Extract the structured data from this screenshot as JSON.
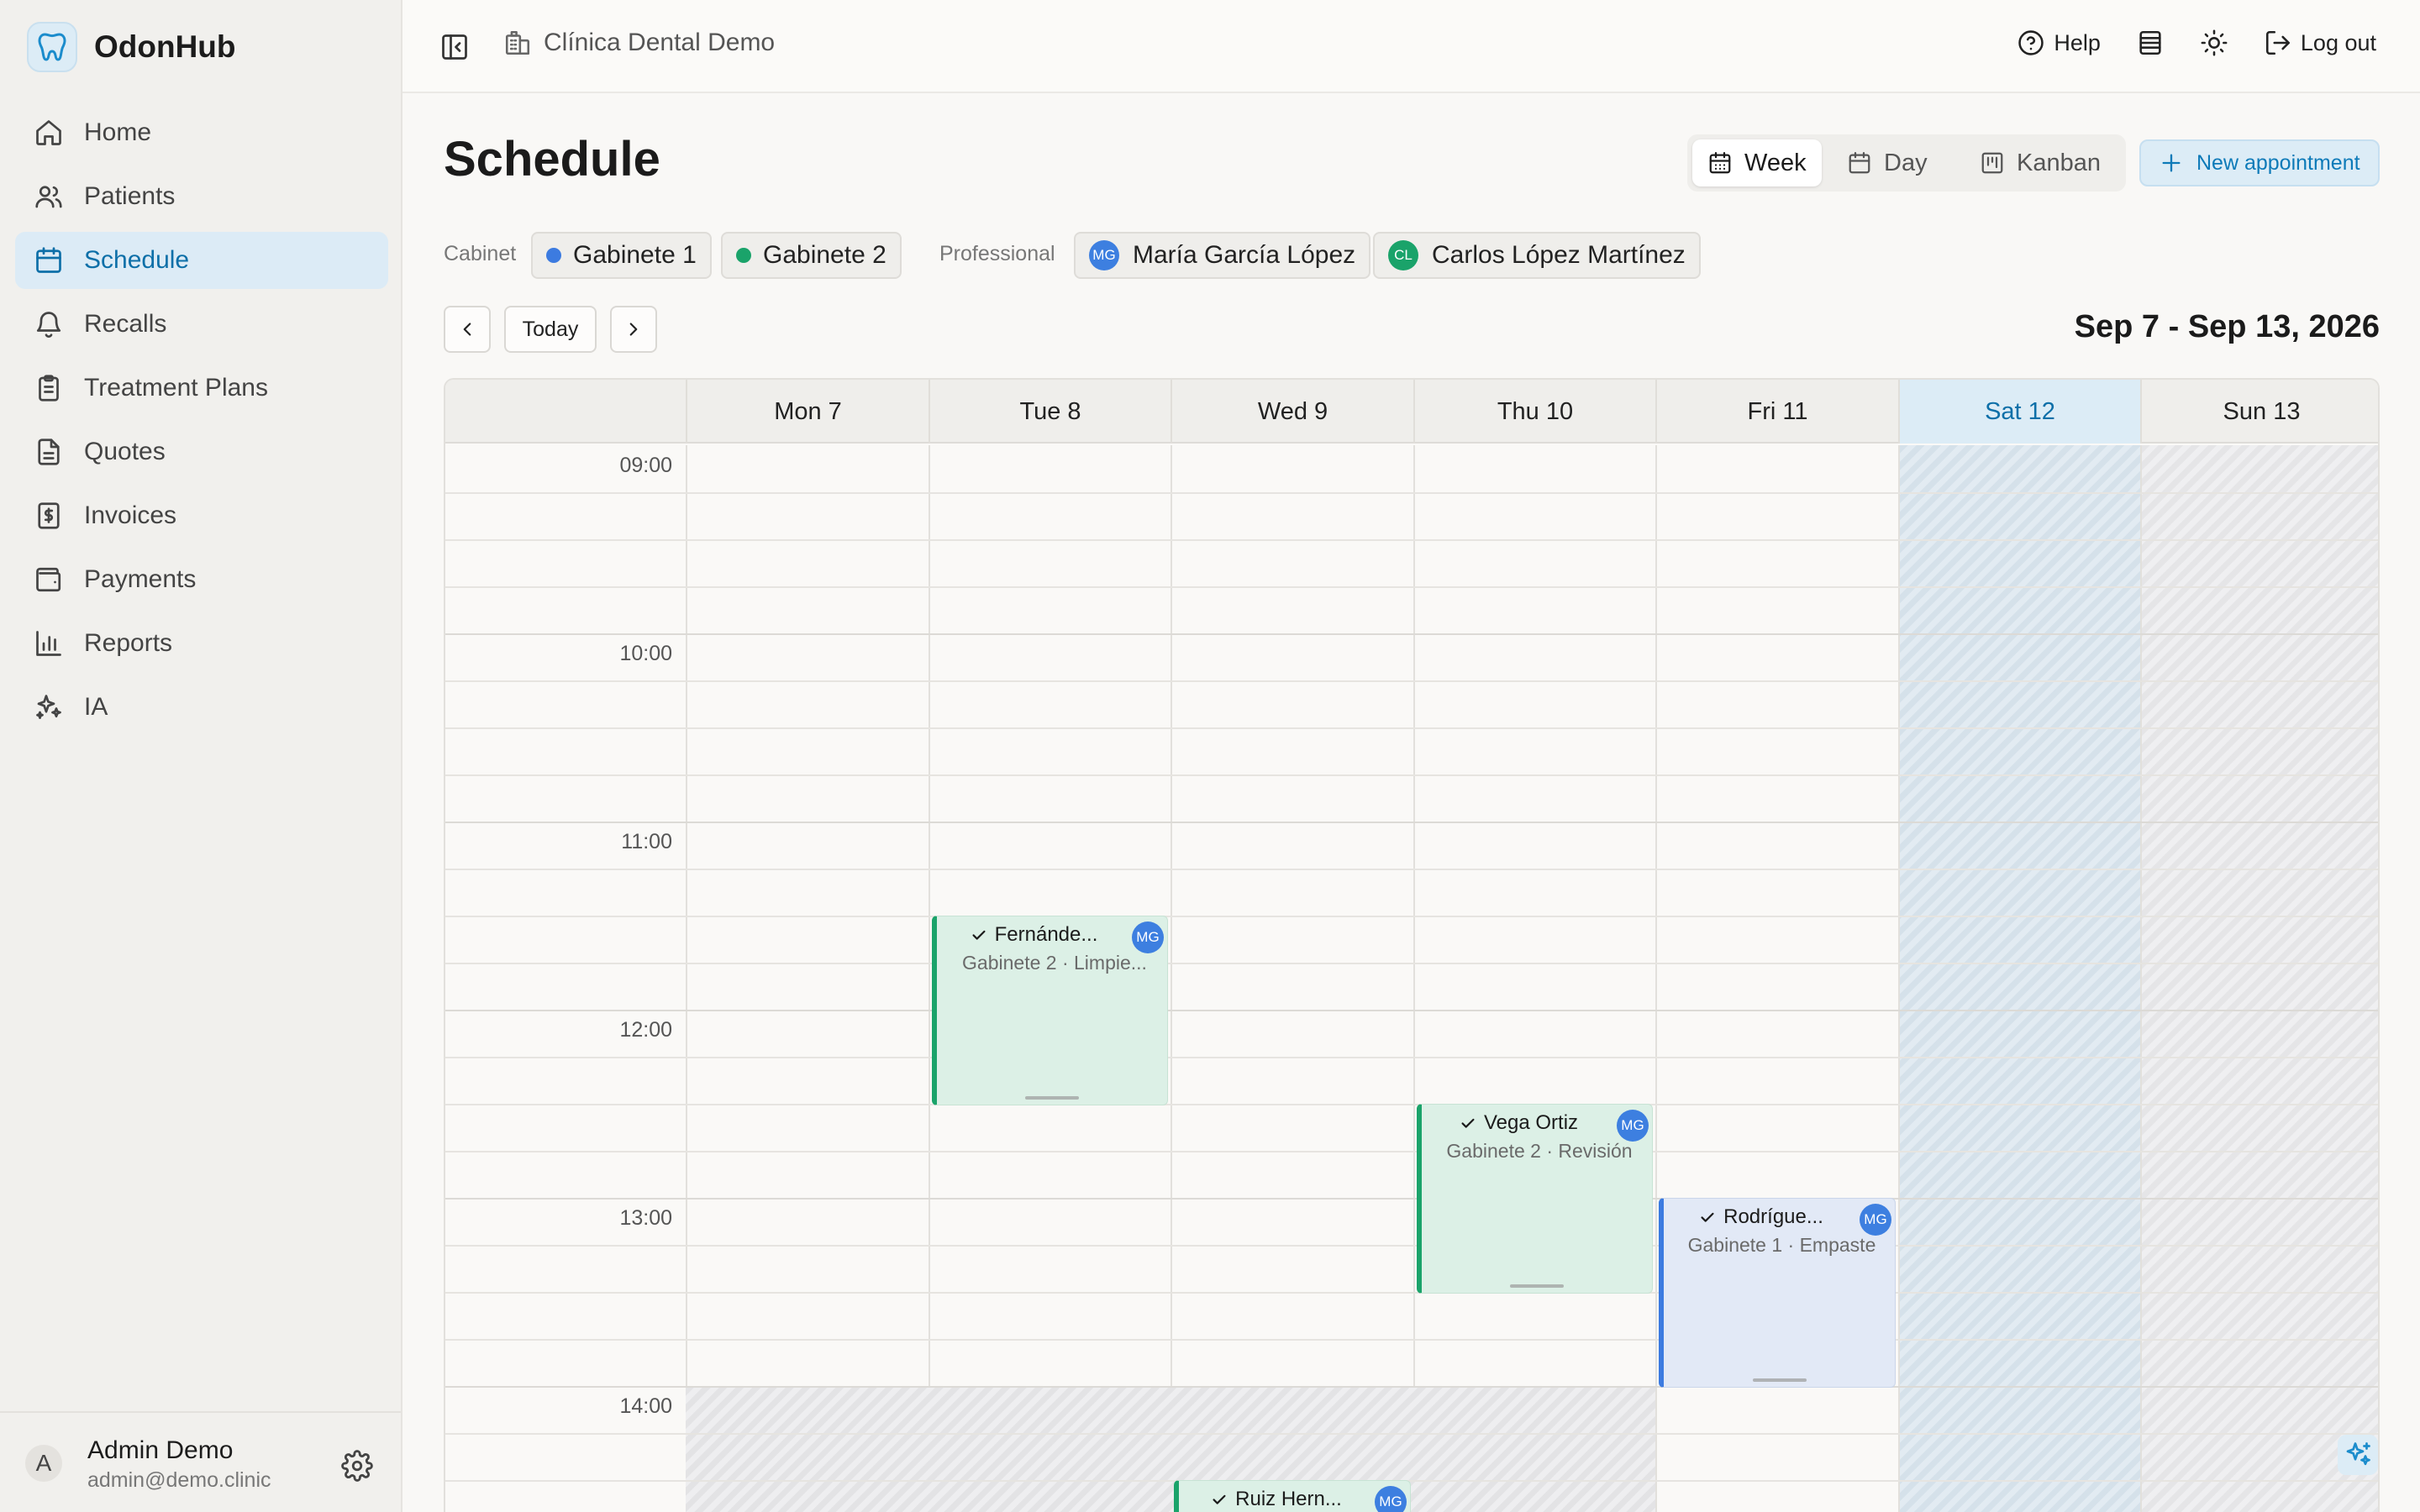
{
  "app": {
    "name": "OdonHub"
  },
  "sidebar": {
    "items": [
      {
        "label": "Home",
        "icon": "home-icon"
      },
      {
        "label": "Patients",
        "icon": "users-icon"
      },
      {
        "label": "Schedule",
        "icon": "calendar-icon",
        "active": true
      },
      {
        "label": "Recalls",
        "icon": "bell-icon"
      },
      {
        "label": "Treatment Plans",
        "icon": "clipboard-icon"
      },
      {
        "label": "Quotes",
        "icon": "file-text-icon"
      },
      {
        "label": "Invoices",
        "icon": "receipt-icon"
      },
      {
        "label": "Payments",
        "icon": "wallet-icon"
      },
      {
        "label": "Reports",
        "icon": "bar-chart-icon"
      },
      {
        "label": "IA",
        "icon": "sparkles-icon"
      }
    ],
    "user": {
      "initial": "A",
      "name": "Admin Demo",
      "email": "admin@demo.clinic"
    }
  },
  "topbar": {
    "clinic": "Clínica Dental Demo",
    "help": "Help",
    "logout": "Log out"
  },
  "page": {
    "title": "Schedule",
    "views": {
      "week": "Week",
      "day": "Day",
      "kanban": "Kanban",
      "active": "Week"
    },
    "new_appointment": "New appointment"
  },
  "filters": {
    "cabinet_label": "Cabinet",
    "cabinets": [
      {
        "name": "Gabinete 1",
        "color": "#3c7be0"
      },
      {
        "name": "Gabinete 2",
        "color": "#1aa36a"
      }
    ],
    "professional_label": "Professional",
    "professionals": [
      {
        "initials": "MG",
        "name": "María García López",
        "color": "#3d7fe0"
      },
      {
        "initials": "CL",
        "name": "Carlos López Martínez",
        "color": "#1aa36a"
      }
    ]
  },
  "navigation": {
    "today": "Today",
    "range": "Sep 7 - Sep 13, 2026"
  },
  "calendar": {
    "days": [
      {
        "label": "Mon 7"
      },
      {
        "label": "Tue 8"
      },
      {
        "label": "Wed 9"
      },
      {
        "label": "Thu 10"
      },
      {
        "label": "Fri 11"
      },
      {
        "label": "Sat 12",
        "today": true
      },
      {
        "label": "Sun 13"
      }
    ],
    "hours": [
      "09:00",
      "10:00",
      "11:00",
      "12:00",
      "13:00",
      "14:00"
    ],
    "appointments": [
      {
        "name": "Fernánde...",
        "detail": "Gabinete 2 · Limpie...",
        "initials": "MG",
        "status": "confirmed"
      },
      {
        "name": "Vega Ortiz",
        "detail": "Gabinete 2 · Revisión",
        "initials": "MG",
        "status": "confirmed"
      },
      {
        "name": "Rodrígue...",
        "detail": "Gabinete 1 · Empaste",
        "initials": "MG",
        "status": "confirmed"
      },
      {
        "name": "Ruiz Hern...",
        "detail": "",
        "initials": "MG",
        "status": "confirmed"
      }
    ]
  }
}
